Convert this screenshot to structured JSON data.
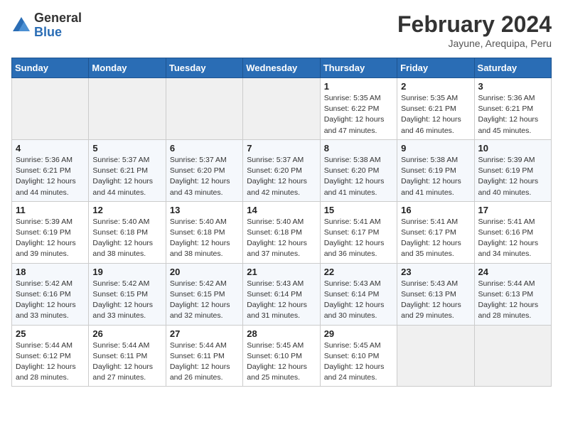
{
  "header": {
    "logo_general": "General",
    "logo_blue": "Blue",
    "title": "February 2024",
    "subtitle": "Jayune, Arequipa, Peru"
  },
  "days_of_week": [
    "Sunday",
    "Monday",
    "Tuesday",
    "Wednesday",
    "Thursday",
    "Friday",
    "Saturday"
  ],
  "weeks": [
    [
      {
        "num": "",
        "info": ""
      },
      {
        "num": "",
        "info": ""
      },
      {
        "num": "",
        "info": ""
      },
      {
        "num": "",
        "info": ""
      },
      {
        "num": "1",
        "info": "Sunrise: 5:35 AM\nSunset: 6:22 PM\nDaylight: 12 hours and 47 minutes."
      },
      {
        "num": "2",
        "info": "Sunrise: 5:35 AM\nSunset: 6:21 PM\nDaylight: 12 hours and 46 minutes."
      },
      {
        "num": "3",
        "info": "Sunrise: 5:36 AM\nSunset: 6:21 PM\nDaylight: 12 hours and 45 minutes."
      }
    ],
    [
      {
        "num": "4",
        "info": "Sunrise: 5:36 AM\nSunset: 6:21 PM\nDaylight: 12 hours and 44 minutes."
      },
      {
        "num": "5",
        "info": "Sunrise: 5:37 AM\nSunset: 6:21 PM\nDaylight: 12 hours and 44 minutes."
      },
      {
        "num": "6",
        "info": "Sunrise: 5:37 AM\nSunset: 6:20 PM\nDaylight: 12 hours and 43 minutes."
      },
      {
        "num": "7",
        "info": "Sunrise: 5:37 AM\nSunset: 6:20 PM\nDaylight: 12 hours and 42 minutes."
      },
      {
        "num": "8",
        "info": "Sunrise: 5:38 AM\nSunset: 6:20 PM\nDaylight: 12 hours and 41 minutes."
      },
      {
        "num": "9",
        "info": "Sunrise: 5:38 AM\nSunset: 6:19 PM\nDaylight: 12 hours and 41 minutes."
      },
      {
        "num": "10",
        "info": "Sunrise: 5:39 AM\nSunset: 6:19 PM\nDaylight: 12 hours and 40 minutes."
      }
    ],
    [
      {
        "num": "11",
        "info": "Sunrise: 5:39 AM\nSunset: 6:19 PM\nDaylight: 12 hours and 39 minutes."
      },
      {
        "num": "12",
        "info": "Sunrise: 5:40 AM\nSunset: 6:18 PM\nDaylight: 12 hours and 38 minutes."
      },
      {
        "num": "13",
        "info": "Sunrise: 5:40 AM\nSunset: 6:18 PM\nDaylight: 12 hours and 38 minutes."
      },
      {
        "num": "14",
        "info": "Sunrise: 5:40 AM\nSunset: 6:18 PM\nDaylight: 12 hours and 37 minutes."
      },
      {
        "num": "15",
        "info": "Sunrise: 5:41 AM\nSunset: 6:17 PM\nDaylight: 12 hours and 36 minutes."
      },
      {
        "num": "16",
        "info": "Sunrise: 5:41 AM\nSunset: 6:17 PM\nDaylight: 12 hours and 35 minutes."
      },
      {
        "num": "17",
        "info": "Sunrise: 5:41 AM\nSunset: 6:16 PM\nDaylight: 12 hours and 34 minutes."
      }
    ],
    [
      {
        "num": "18",
        "info": "Sunrise: 5:42 AM\nSunset: 6:16 PM\nDaylight: 12 hours and 33 minutes."
      },
      {
        "num": "19",
        "info": "Sunrise: 5:42 AM\nSunset: 6:15 PM\nDaylight: 12 hours and 33 minutes."
      },
      {
        "num": "20",
        "info": "Sunrise: 5:42 AM\nSunset: 6:15 PM\nDaylight: 12 hours and 32 minutes."
      },
      {
        "num": "21",
        "info": "Sunrise: 5:43 AM\nSunset: 6:14 PM\nDaylight: 12 hours and 31 minutes."
      },
      {
        "num": "22",
        "info": "Sunrise: 5:43 AM\nSunset: 6:14 PM\nDaylight: 12 hours and 30 minutes."
      },
      {
        "num": "23",
        "info": "Sunrise: 5:43 AM\nSunset: 6:13 PM\nDaylight: 12 hours and 29 minutes."
      },
      {
        "num": "24",
        "info": "Sunrise: 5:44 AM\nSunset: 6:13 PM\nDaylight: 12 hours and 28 minutes."
      }
    ],
    [
      {
        "num": "25",
        "info": "Sunrise: 5:44 AM\nSunset: 6:12 PM\nDaylight: 12 hours and 28 minutes."
      },
      {
        "num": "26",
        "info": "Sunrise: 5:44 AM\nSunset: 6:11 PM\nDaylight: 12 hours and 27 minutes."
      },
      {
        "num": "27",
        "info": "Sunrise: 5:44 AM\nSunset: 6:11 PM\nDaylight: 12 hours and 26 minutes."
      },
      {
        "num": "28",
        "info": "Sunrise: 5:45 AM\nSunset: 6:10 PM\nDaylight: 12 hours and 25 minutes."
      },
      {
        "num": "29",
        "info": "Sunrise: 5:45 AM\nSunset: 6:10 PM\nDaylight: 12 hours and 24 minutes."
      },
      {
        "num": "",
        "info": ""
      },
      {
        "num": "",
        "info": ""
      }
    ]
  ]
}
